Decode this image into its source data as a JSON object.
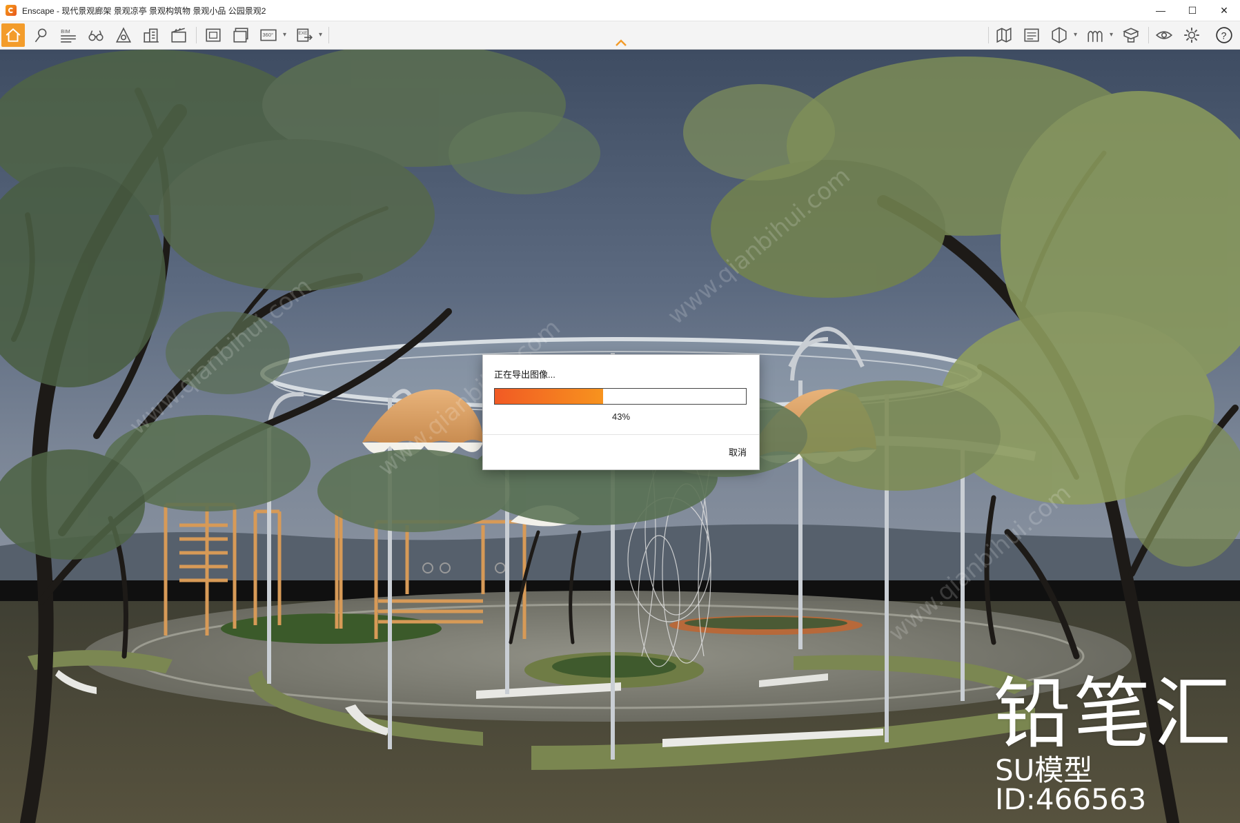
{
  "window": {
    "title": "Enscape - 现代景观廊架 景观凉亭 景观构筑物 景观小品 公园景观2",
    "minimize_glyph": "—",
    "maximize_glyph": "☐",
    "close_glyph": "✕"
  },
  "toolbar": {
    "left_buttons": [
      "home-icon",
      "location-pin-icon",
      "bim-icon",
      "binoculars-icon",
      "asset-library-icon",
      "buildings-icon",
      "video-editor-icon",
      "screenshot-icon",
      "batch-render-icon",
      "panorama-360-icon",
      "export-exe-icon"
    ],
    "right_buttons": [
      "map-icon",
      "view-management-icon",
      "section-icon",
      "atmosphere-icon",
      "materials-icon",
      "visual-settings-icon",
      "settings-icon",
      "help-icon"
    ],
    "bim_label": "BIM",
    "pano_label": "360°",
    "exe_label": "EXE",
    "help_glyph": "?"
  },
  "dialog": {
    "title": "正在导出图像...",
    "progress": 0.43,
    "progress_text": "43%",
    "cancel_label": "取消"
  },
  "watermark": {
    "brand": "铅笔汇",
    "model_id": "SU模型ID:466563"
  },
  "colors": {
    "accent": "#f39c2b",
    "progress_start": "#f15a24",
    "progress_end": "#f7931e"
  }
}
